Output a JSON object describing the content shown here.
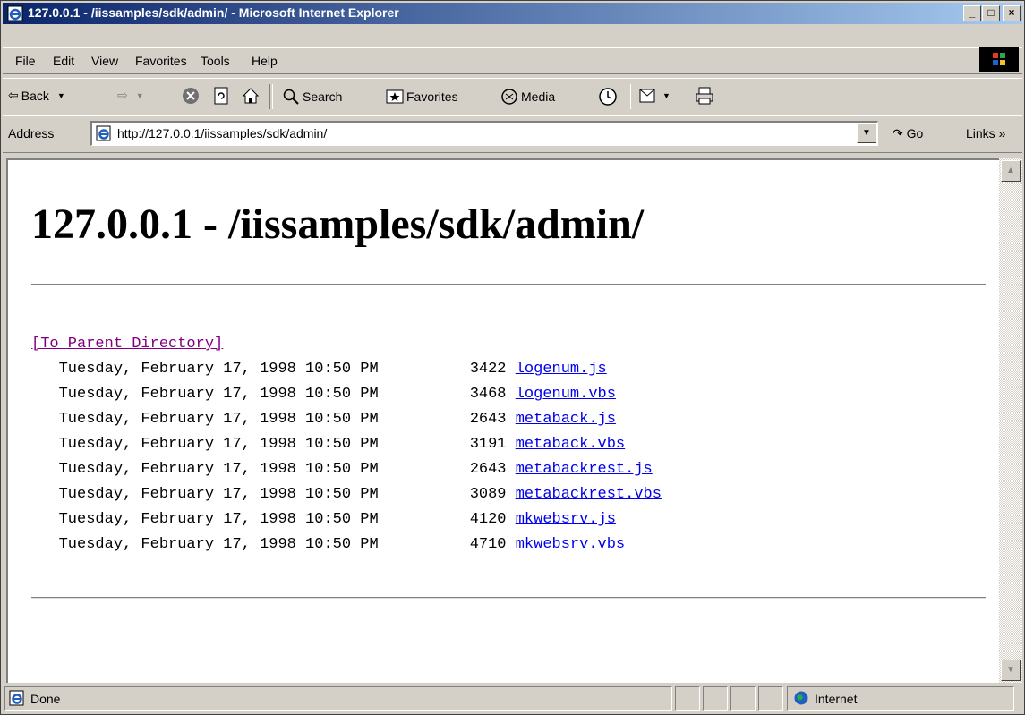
{
  "window": {
    "title": "127.0.0.1 - /iissamples/sdk/admin/ - Microsoft Internet Explorer",
    "min_label": "_",
    "max_label": "□",
    "close_label": "×"
  },
  "menu": {
    "items": [
      "File",
      "Edit",
      "View",
      "Favorites",
      "Tools",
      "Help"
    ]
  },
  "toolbar": {
    "back_label": "Back",
    "search_label": "Search",
    "favorites_label": "Favorites",
    "media_label": "Media"
  },
  "address": {
    "label": "Address",
    "url": "http://127.0.0.1/iissamples/sdk/admin/",
    "go_label": "Go",
    "links_label": "Links »"
  },
  "page": {
    "heading": "127.0.0.1 - /iissamples/sdk/admin/",
    "parent_link": "[To Parent Directory]",
    "files": [
      {
        "date": "Tuesday, February 17, 1998 10:50 PM",
        "size": "3422",
        "name": "logenum.js"
      },
      {
        "date": "Tuesday, February 17, 1998 10:50 PM",
        "size": "3468",
        "name": "logenum.vbs"
      },
      {
        "date": "Tuesday, February 17, 1998 10:50 PM",
        "size": "2643",
        "name": "metaback.js"
      },
      {
        "date": "Tuesday, February 17, 1998 10:50 PM",
        "size": "3191",
        "name": "metaback.vbs"
      },
      {
        "date": "Tuesday, February 17, 1998 10:50 PM",
        "size": "2643",
        "name": "metabackrest.js"
      },
      {
        "date": "Tuesday, February 17, 1998 10:50 PM",
        "size": "3089",
        "name": "metabackrest.vbs"
      },
      {
        "date": "Tuesday, February 17, 1998 10:50 PM",
        "size": "4120",
        "name": "mkwebsrv.js"
      },
      {
        "date": "Tuesday, February 17, 1998 10:50 PM",
        "size": "4710",
        "name": "mkwebsrv.vbs"
      }
    ]
  },
  "status": {
    "text": "Done",
    "zone": "Internet"
  }
}
